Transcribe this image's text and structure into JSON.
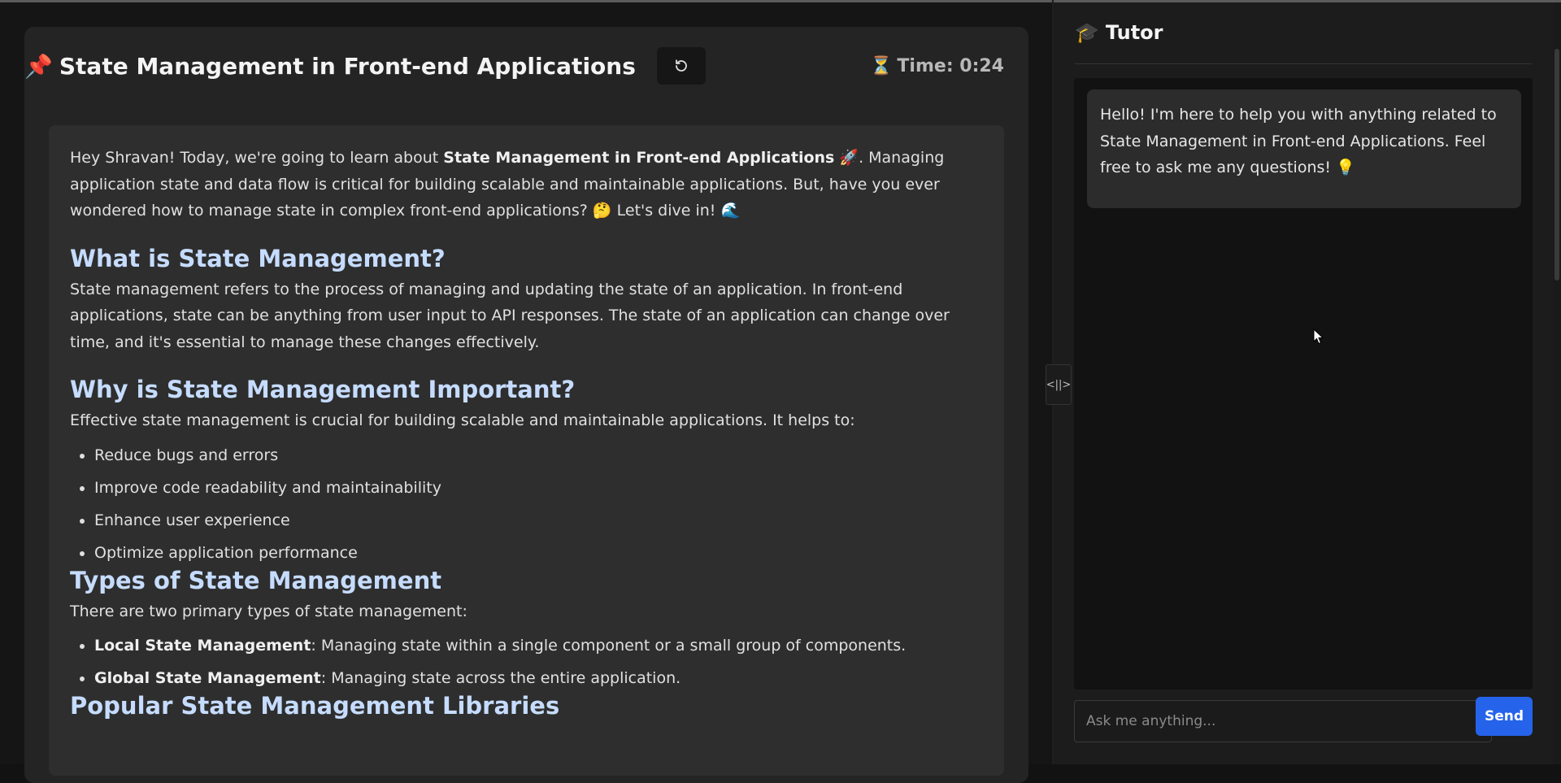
{
  "lesson": {
    "title": "State Management in Front-end Applications",
    "pin_icon": "📌",
    "timer_icon": "⏳",
    "timer_text": "Time: 0:24"
  },
  "content": {
    "intro_prefix": "Hey Shravan! Today, we're going to learn about ",
    "intro_bold": "State Management in Front-end Applications",
    "intro_suffix": " 🚀. Managing application state and data flow is critical for building scalable and maintainable applications. But, have you ever wondered how to manage state in complex front-end applications? 🤔 Let's dive in! 🌊",
    "h_what": "What is State Management?",
    "p_what": "State management refers to the process of managing and updating the state of an application. In front-end applications, state can be anything from user input to API responses. The state of an application can change over time, and it's essential to manage these changes effectively.",
    "h_why": "Why is State Management Important?",
    "p_why": "Effective state management is crucial for building scalable and maintainable applications. It helps to:",
    "why_items": [
      "Reduce bugs and errors",
      "Improve code readability and maintainability",
      "Enhance user experience",
      "Optimize application performance"
    ],
    "h_types": "Types of State Management",
    "p_types": "There are two primary types of state management:",
    "types": [
      {
        "term": "Local State Management",
        "desc": ": Managing state within a single component or a small group of components."
      },
      {
        "term": "Global State Management",
        "desc": ": Managing state across the entire application."
      }
    ],
    "h_libs": "Popular State Management Libraries"
  },
  "tutor": {
    "icon": "🎓",
    "title": "Tutor",
    "message": "Hello! I'm here to help you with anything related to State Management in Front-end Applications. Feel free to ask me any questions! 💡",
    "input_placeholder": "Ask me anything...",
    "send_label": "Send",
    "splitter_label": "<||>"
  }
}
